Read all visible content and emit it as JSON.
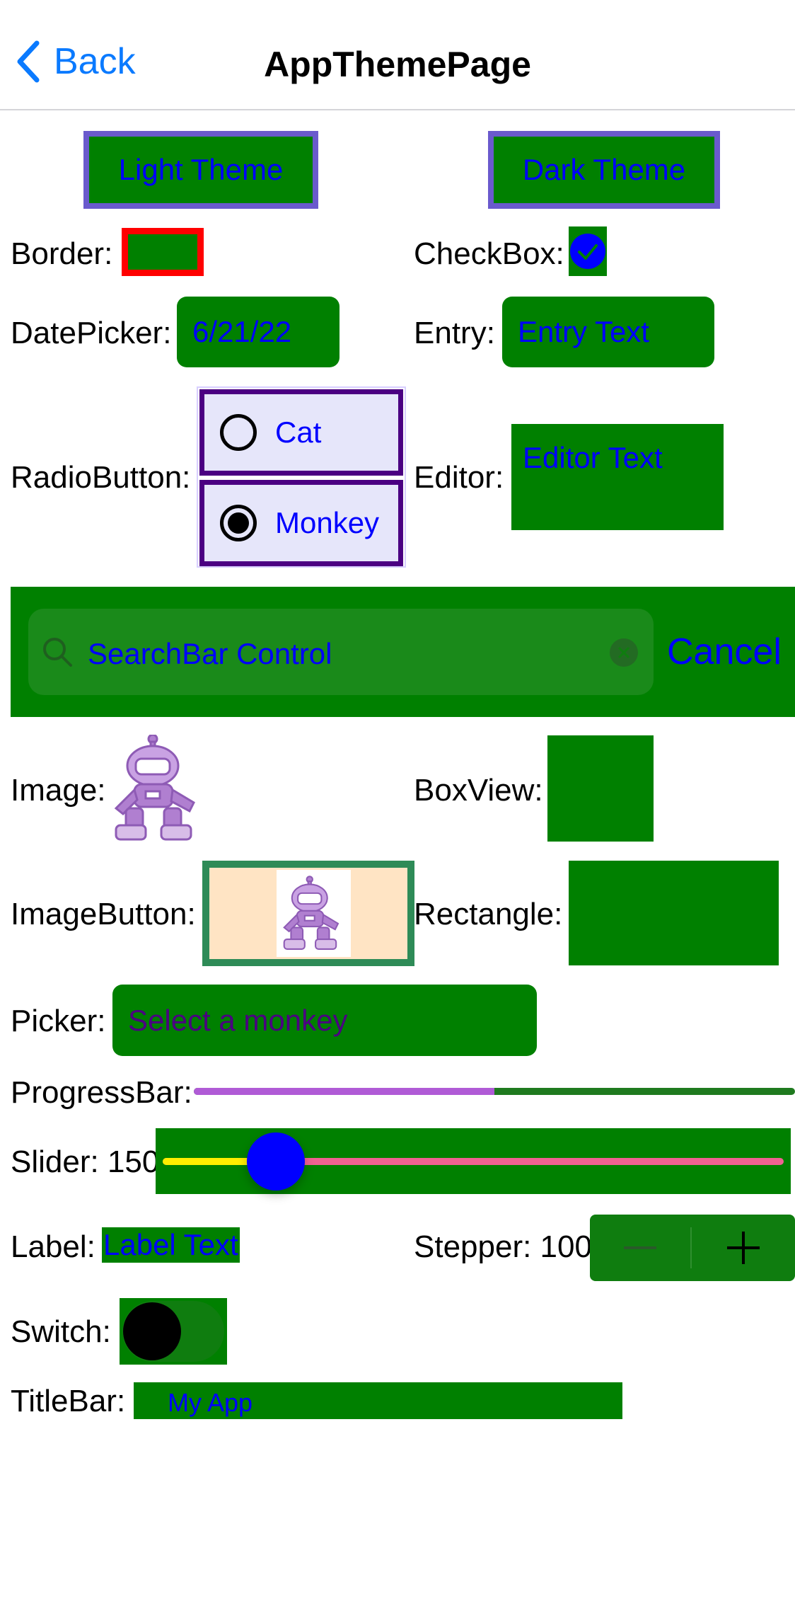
{
  "nav": {
    "back_label": "Back",
    "title": "AppThemePage"
  },
  "theme_buttons": {
    "light": "Light Theme",
    "dark": "Dark Theme"
  },
  "labels": {
    "border": "Border:",
    "checkbox": "CheckBox:",
    "datepicker": "DatePicker:",
    "entry": "Entry:",
    "radiobutton": "RadioButton:",
    "editor": "Editor:",
    "image": "Image:",
    "boxview": "BoxView:",
    "imagebutton": "ImageButton:",
    "rectangle": "Rectangle:",
    "picker": "Picker:",
    "progressbar": "ProgressBar:",
    "slider": "Slider: 150",
    "label": "Label:",
    "stepper": "Stepper: 100",
    "switch": "Switch:",
    "titlebar": "TitleBar:"
  },
  "datepicker_value": "6/21/22",
  "entry_value": "Entry Text",
  "editor_value": "Editor Text",
  "radio_options": [
    {
      "text": "Cat",
      "checked": false
    },
    {
      "text": "Monkey",
      "checked": true
    }
  ],
  "searchbar": {
    "text": "SearchBar Control",
    "cancel": "Cancel"
  },
  "picker_placeholder": "Select a monkey",
  "progress": 0.5,
  "slider_value": 150,
  "label_value": "Label Text",
  "stepper_value": 100,
  "switch_on": false,
  "checkbox_checked": true,
  "titlebar_text": "My App",
  "colors": {
    "accent_green": "#008000",
    "text_blue": "#0000ff",
    "theme_button_border": "#6a5acd",
    "border_stroke": "#ff0000",
    "radio_border": "#4b0082",
    "progress_fill": "#b05bd6",
    "slider_min_track": "#ffee00",
    "slider_max_track": "#f06292",
    "slider_thumb": "#0000ff",
    "nav_blue": "#0a7aff"
  }
}
